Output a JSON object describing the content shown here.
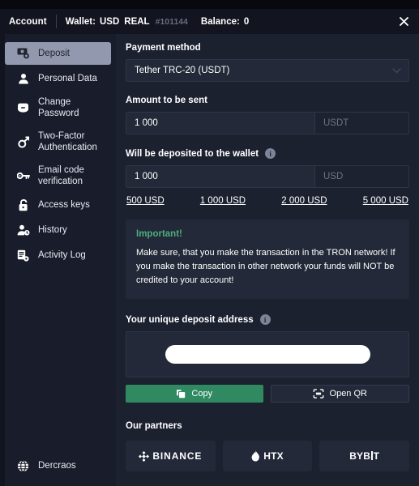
{
  "header": {
    "account_label": "Account",
    "wallet_label": "Wallet:",
    "currency": "USD",
    "wallet_type": "REAL",
    "wallet_id": "#101144",
    "balance_label": "Balance:",
    "balance_value": "0",
    "close_icon": "close-icon"
  },
  "sidebar": {
    "items": [
      {
        "label": "Deposit",
        "icon": "deposit-money-icon",
        "active": true
      },
      {
        "label": "Personal Data",
        "icon": "user-icon",
        "active": false
      },
      {
        "label": "Change Password",
        "icon": "wallet-card-icon",
        "active": false
      },
      {
        "label": "Two-Factor Authentication",
        "icon": "key-round-icon",
        "active": false
      },
      {
        "label": "Email code verification",
        "icon": "key-icon",
        "active": false
      },
      {
        "label": "Access keys",
        "icon": "unlock-icon",
        "active": false
      },
      {
        "label": "History",
        "icon": "user-clock-icon",
        "active": false
      },
      {
        "label": "Activity Log",
        "icon": "list-gear-icon",
        "active": false
      }
    ],
    "footer": {
      "label": "Dercraos",
      "icon": "globe-icon"
    }
  },
  "main": {
    "payment_method": {
      "label": "Payment method",
      "selected": "Tether TRC-20 (USDT)",
      "chevron_icon": "chevron-down-icon"
    },
    "amount_sent": {
      "label": "Amount to be sent",
      "value": "1 000",
      "placeholder": "Amount",
      "suffix": "USDT"
    },
    "amount_deposited": {
      "label": "Will be deposited to the wallet",
      "info_icon": "info-icon",
      "value": "1 000",
      "placeholder": "Amount",
      "suffix": "USD"
    },
    "quick_amounts": [
      "500 USD",
      "1 000 USD",
      "2 000 USD",
      "5 000 USD"
    ],
    "important": {
      "title": "Important!",
      "text": "Make sure, that you make the transaction in the TRON network! If you make the transaction in other network your funds will NOT be credited to your account!"
    },
    "deposit_address": {
      "label": "Your unique deposit address",
      "info_icon": "info-icon",
      "value": ""
    },
    "buttons": {
      "copy": {
        "label": "Copy",
        "icon": "copy-icon"
      },
      "open_qr": {
        "label": "Open QR",
        "icon": "qr-scan-icon"
      }
    },
    "partners": {
      "title": "Our partners",
      "items": [
        {
          "name": "BINANCE",
          "icon": "binance-logo-icon"
        },
        {
          "name": "HTX",
          "icon": "htx-logo-icon"
        },
        {
          "name": "BYBIT",
          "icon": "bybit-logo-icon"
        }
      ]
    }
  },
  "colors": {
    "accent_green": "#2f8a62",
    "important_green": "#4caf7d",
    "panel_bg": "#1c2130",
    "sidebar_bg": "#191d2b",
    "header_bg": "#12151f",
    "field_bg": "#232938",
    "active_nav_bg": "#9299ae"
  }
}
